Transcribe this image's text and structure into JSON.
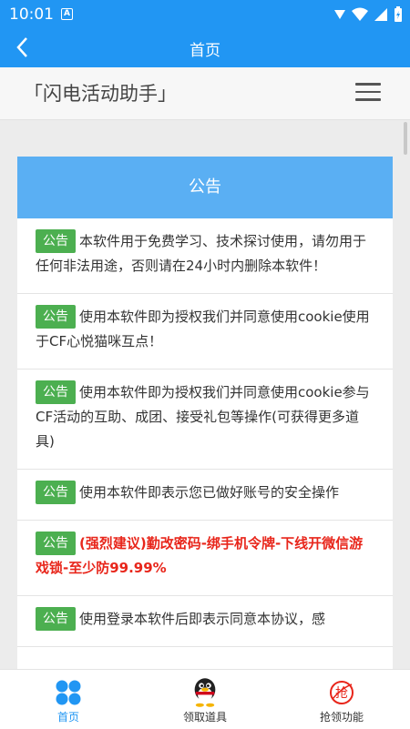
{
  "status": {
    "time": "10:01",
    "notification_icon": "A"
  },
  "toolbar": {
    "title": "首页"
  },
  "appbar": {
    "brand": "「闪电活动助手」"
  },
  "notice": {
    "heading": "公告",
    "badge": "公告",
    "items": [
      {
        "text": "本软件用于免费学习、技术探讨使用，请勿用于任何非法用途，否则请在24小时内删除本软件！",
        "warn": false
      },
      {
        "text": "使用本软件即为授权我们并同意使用cookie使用于CF心悦猫咪互点！",
        "warn": false
      },
      {
        "text": "使用本软件即为授权我们并同意使用cookie参与CF活动的互助、成团、接受礼包等操作(可获得更多道具)",
        "warn": false
      },
      {
        "text": "使用本软件即表示您已做好账号的安全操作",
        "warn": false
      },
      {
        "text": "(强烈建议)勤改密码-绑手机令牌-下线开微信游戏锁-至少防99.99%",
        "warn": true
      },
      {
        "text": "使用登录本软件后即表示同意本协议，感",
        "warn": false
      }
    ]
  },
  "tabs": [
    {
      "label": "首页",
      "icon": "grid-icon",
      "active": true
    },
    {
      "label": "领取道具",
      "icon": "penguin-icon",
      "active": false
    },
    {
      "label": "抢领功能",
      "icon": "grab-icon",
      "active": false
    }
  ],
  "colors": {
    "primary": "#2196f3",
    "header": "#5aaff3",
    "badge": "#4caf50",
    "warn": "#e8261b"
  }
}
